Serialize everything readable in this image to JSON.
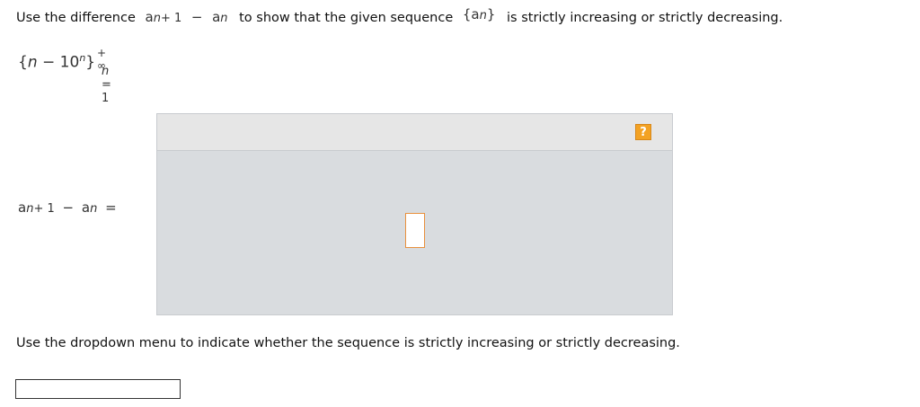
{
  "question": {
    "prefix": "Use the difference",
    "a1": "a",
    "n1": "n",
    "plus_one": "+ 1",
    "minus": "−",
    "a2": "a",
    "n2": "n",
    "middle": "to show that the given sequence",
    "set_open": "{",
    "a3": "a",
    "n3": "n",
    "set_close": "}",
    "suffix": "is strictly increasing or strictly decreasing."
  },
  "sequence": {
    "open": "{",
    "n": "n",
    "minus": "−",
    "base": "10",
    "exp": "n",
    "close": "}",
    "upper": "+ ∞",
    "lower_n": "n",
    "lower_eq": "= 1"
  },
  "difference_label": {
    "a1": "a",
    "n1": "n",
    "plus_one": "+ 1",
    "minus": "−",
    "a2": "a",
    "n2": "n",
    "eq": "="
  },
  "help_button": {
    "label": "?"
  },
  "instruction": "Use the dropdown menu to indicate whether the sequence is strictly increasing or strictly decreasing.",
  "dropdown": {
    "value": ""
  }
}
